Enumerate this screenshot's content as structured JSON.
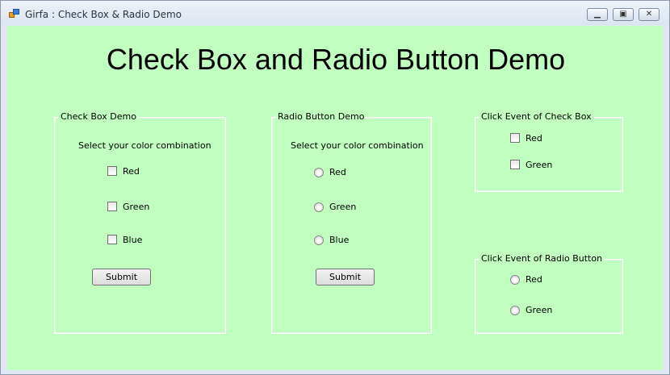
{
  "window": {
    "title": "Girfa : Check Box & Radio Demo",
    "minimize_glyph": "▁",
    "restore_glyph": "▣",
    "close_glyph": "✕"
  },
  "heading": "Check Box and Radio Button Demo",
  "checkbox_demo": {
    "legend": "Check Box Demo",
    "prompt": "Select your color combination",
    "items": [
      {
        "label": "Red",
        "checked": false
      },
      {
        "label": "Green",
        "checked": false
      },
      {
        "label": "Blue",
        "checked": false
      }
    ],
    "submit_label": "Submit"
  },
  "radio_demo": {
    "legend": "Radio Button Demo",
    "prompt": "Select your color combination",
    "items": [
      {
        "label": "Red",
        "selected": false
      },
      {
        "label": "Green",
        "selected": false
      },
      {
        "label": "Blue",
        "selected": false
      }
    ],
    "submit_label": "Submit"
  },
  "checkbox_click_event": {
    "legend": "Click Event of Check Box",
    "items": [
      {
        "label": "Red",
        "checked": false
      },
      {
        "label": "Green",
        "checked": false
      }
    ]
  },
  "radio_click_event": {
    "legend": "Click Event of Radio Button",
    "items": [
      {
        "label": "Red",
        "selected": false
      },
      {
        "label": "Green",
        "selected": false
      }
    ]
  },
  "colors": {
    "client_background": "#c0ffc0",
    "titlebar": "#dbe4ef"
  }
}
